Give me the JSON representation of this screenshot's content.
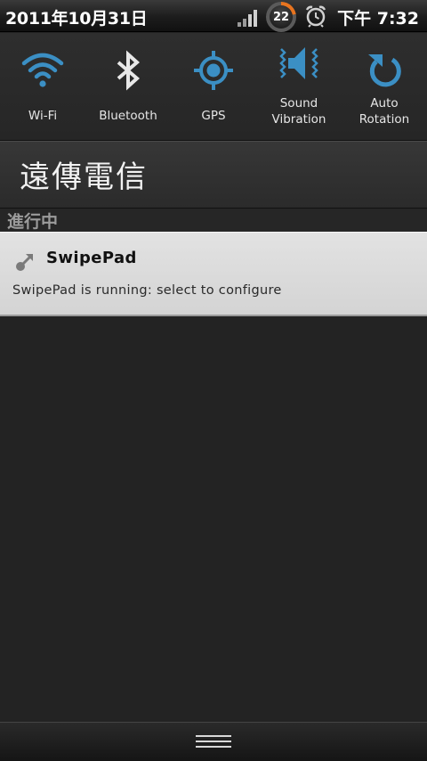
{
  "status_bar": {
    "date": "2011年10月31日",
    "battery_level": "22",
    "time": "下午 7:32"
  },
  "quick_settings": {
    "accent_color": "#3b8fc4",
    "tiles": [
      {
        "label": "Wi-Fi",
        "icon": "wifi-icon"
      },
      {
        "label": "Bluetooth",
        "icon": "bluetooth-icon"
      },
      {
        "label": "GPS",
        "icon": "gps-icon"
      },
      {
        "label_line1": "Sound",
        "label_line2": "Vibration",
        "icon": "sound-icon"
      },
      {
        "label_line1": "Auto",
        "label_line2": "Rotation",
        "icon": "rotation-icon"
      }
    ]
  },
  "carrier": {
    "name": "遠傳電信"
  },
  "ongoing": {
    "header": "進行中"
  },
  "notification": {
    "title": "SwipePad",
    "text": "SwipePad is running: select to configure",
    "icon": "swipepad-icon"
  },
  "bottom_bar": {
    "handle_icon": "drag-handle-icon"
  }
}
